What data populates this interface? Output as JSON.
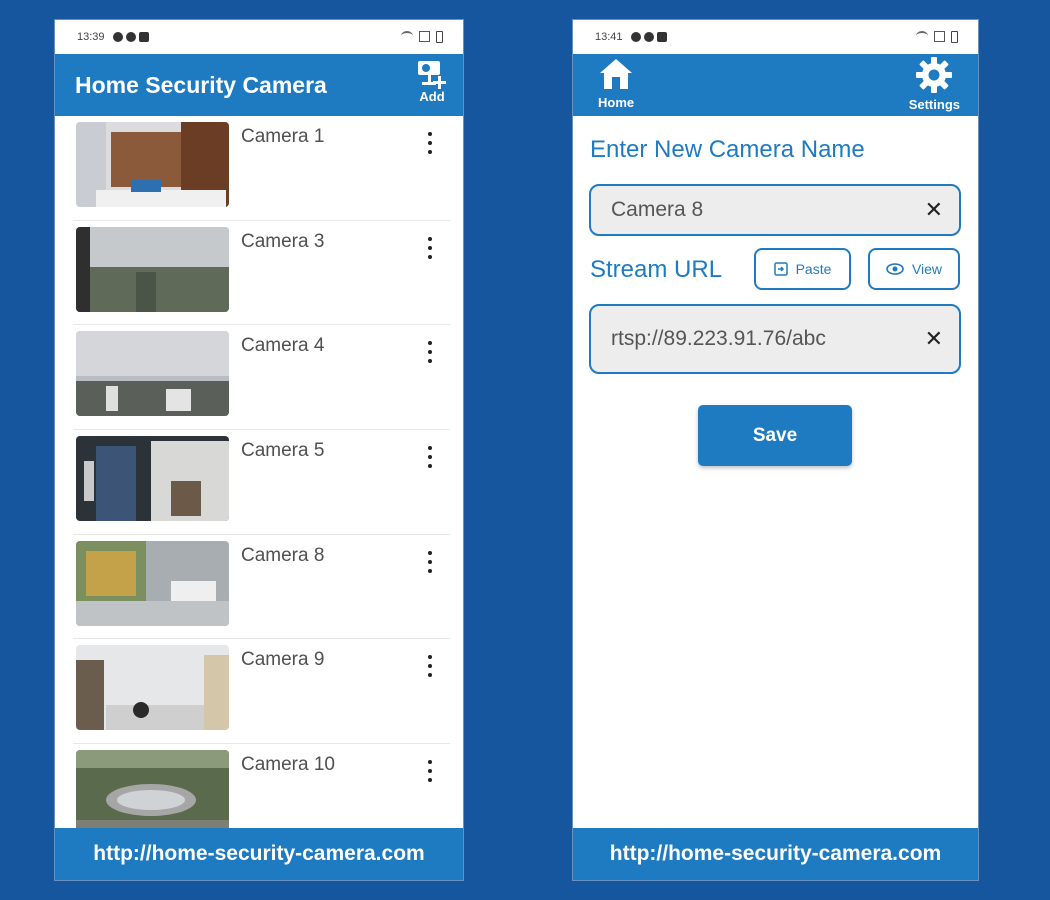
{
  "left_screen": {
    "status_time": "13:39",
    "app_title": "Home Security Camera",
    "add_label": "Add",
    "cameras": [
      {
        "name": "Camera 1"
      },
      {
        "name": "Camera 3"
      },
      {
        "name": "Camera 4"
      },
      {
        "name": "Camera 5"
      },
      {
        "name": "Camera 8"
      },
      {
        "name": "Camera 9"
      },
      {
        "name": "Camera 10"
      }
    ],
    "footer_url": "http://home-security-camera.com"
  },
  "right_screen": {
    "status_time": "13:41",
    "nav": {
      "home_label": "Home",
      "settings_label": "Settings"
    },
    "name_label": "Enter New Camera Name",
    "name_value": "Camera 8",
    "stream_label": "Stream URL",
    "paste_label": "Paste",
    "view_label": "View",
    "url_value": "rtsp://89.223.91.76/abc",
    "save_label": "Save",
    "footer_url": "http://home-security-camera.com"
  },
  "colors": {
    "background": "#15569f",
    "accent": "#1e7bc2"
  }
}
